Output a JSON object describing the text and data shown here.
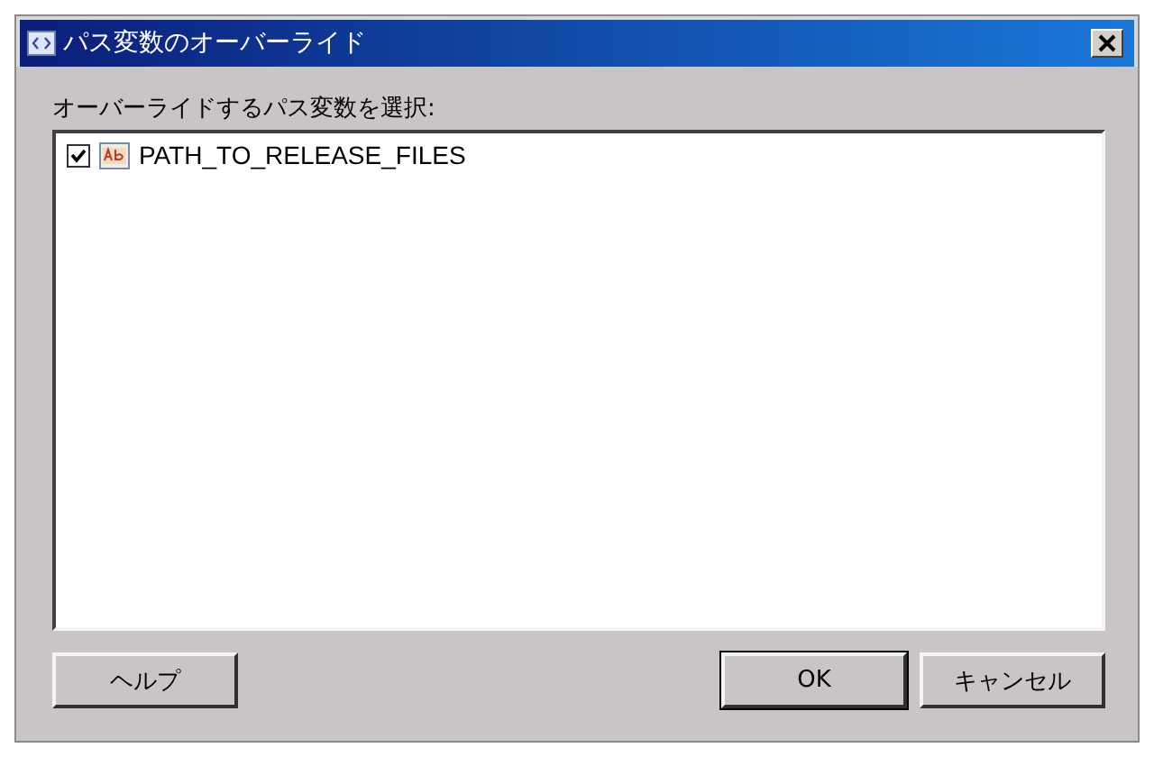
{
  "window": {
    "title": "パス変数のオーバーライド"
  },
  "prompt": "オーバーライドするパス変数を選択:",
  "variables": [
    {
      "name": "PATH_TO_RELEASE_FILES",
      "checked": true
    }
  ],
  "buttons": [
    {
      "label": "ヘルプ",
      "kind": "left",
      "default": false
    },
    {
      "label": "OK",
      "kind": "right",
      "default": true
    },
    {
      "label": "キャンセル",
      "kind": "right",
      "default": false
    }
  ]
}
